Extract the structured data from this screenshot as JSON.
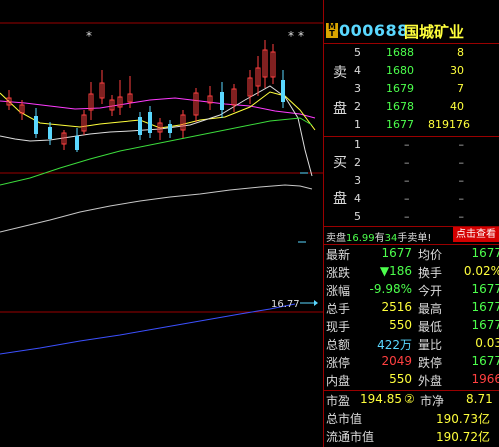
{
  "chart": {
    "price_label": "16.77",
    "star_markers": [
      "*",
      "*",
      "*"
    ]
  },
  "stock": {
    "badge": "M\nT",
    "code": "000688",
    "name": "国城矿业"
  },
  "orderbook": {
    "sell_side_label": [
      "卖",
      "盘"
    ],
    "buy_side_label": [
      "买",
      "盘"
    ],
    "asks": [
      {
        "level": "5",
        "price": "1688",
        "volume": "8"
      },
      {
        "level": "4",
        "price": "1680",
        "volume": "30"
      },
      {
        "level": "3",
        "price": "1679",
        "volume": "7"
      },
      {
        "level": "2",
        "price": "1678",
        "volume": "40"
      },
      {
        "level": "1",
        "price": "1677",
        "volume": "819176"
      }
    ],
    "bids": [
      {
        "level": "1",
        "price": "–",
        "volume": "–"
      },
      {
        "level": "2",
        "price": "–",
        "volume": "–"
      },
      {
        "level": "3",
        "price": "–",
        "volume": "–"
      },
      {
        "level": "4",
        "price": "–",
        "volume": "–"
      },
      {
        "level": "5",
        "price": "–",
        "volume": "–"
      }
    ]
  },
  "notice": {
    "prefix": "卖盘",
    "price": "16.99",
    "mid": "有",
    "count": "34",
    "suffix": "手卖单!",
    "button": "点击查看"
  },
  "quotes": [
    {
      "l1": "最新",
      "v1": "1677",
      "c1": "#4cff4c",
      "l2": "均价",
      "v2": "1677",
      "c2": "#4cff4c"
    },
    {
      "l1": "涨跌",
      "v1": "▼186",
      "c1": "#4cff4c",
      "l2": "换手",
      "v2": "0.02%",
      "c2": "#ffff3c"
    },
    {
      "l1": "涨幅",
      "v1": "-9.98%",
      "c1": "#4cff4c",
      "l2": "今开",
      "v2": "1677",
      "c2": "#4cff4c"
    },
    {
      "l1": "总手",
      "v1": "2516",
      "c1": "#ffff3c",
      "l2": "最高",
      "v2": "1677",
      "c2": "#4cff4c"
    },
    {
      "l1": "现手",
      "v1": "550",
      "c1": "#ffff3c",
      "l2": "最低",
      "v2": "1677",
      "c2": "#4cff4c"
    },
    {
      "l1": "总额",
      "v1": "422万",
      "c1": "#5ad8ff",
      "l2": "量比",
      "v2": "0.03",
      "c2": "#ffff3c"
    },
    {
      "l1": "涨停",
      "v1": "2049",
      "c1": "#ff4040",
      "l2": "跌停",
      "v2": "1677",
      "c2": "#4cff4c"
    },
    {
      "l1": "内盘",
      "v1": "550",
      "c1": "#ffff3c",
      "l2": "外盘",
      "v2": "1966",
      "c2": "#ff4040"
    }
  ],
  "valuation": {
    "pe_label": "市盈",
    "pe_value": "194.85",
    "pe_note": "②",
    "pb_label": "市净",
    "pb_value": "8.71",
    "mcap_label": "总市值",
    "mcap_value": "190.73亿",
    "float_label": "流通市值",
    "float_value": "190.72亿"
  },
  "colors": {
    "up": "#ff4040",
    "down": "#4cff4c",
    "neutral": "#ffff3c",
    "accent": "#5ad8ff",
    "border": "#9a0000"
  }
}
